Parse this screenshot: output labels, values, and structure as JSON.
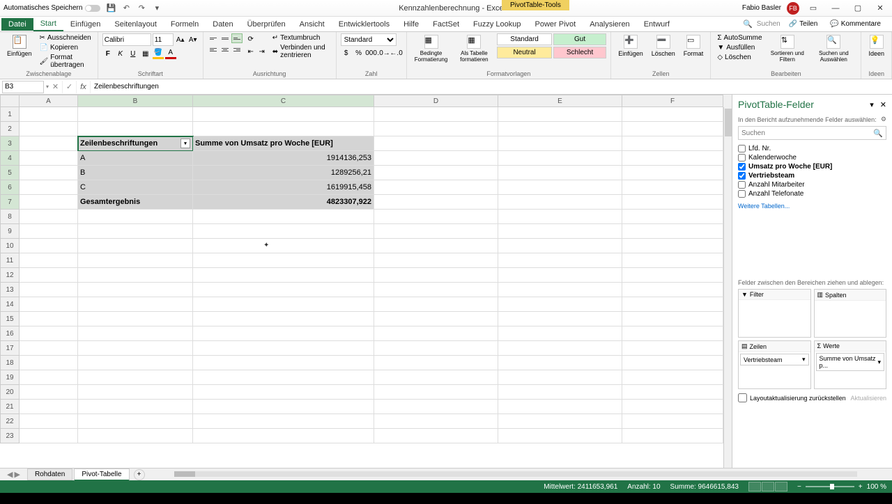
{
  "titlebar": {
    "autosave": "Automatisches Speichern",
    "doc_title": "Kennzahlenberechnung - Excel",
    "context_tool": "PivotTable-Tools",
    "user_name": "Fabio Basler",
    "user_initials": "FB"
  },
  "tabs": {
    "file": "Datei",
    "start": "Start",
    "einfuegen": "Einfügen",
    "seitenlayout": "Seitenlayout",
    "formeln": "Formeln",
    "daten": "Daten",
    "ueberpruefen": "Überprüfen",
    "ansicht": "Ansicht",
    "entwickler": "Entwicklertools",
    "hilfe": "Hilfe",
    "factset": "FactSet",
    "fuzzy": "Fuzzy Lookup",
    "powerpivot": "Power Pivot",
    "analysieren": "Analysieren",
    "entwurf": "Entwurf",
    "suchen": "Suchen",
    "teilen": "Teilen",
    "kommentare": "Kommentare"
  },
  "ribbon": {
    "clipboard": {
      "einfuegen": "Einfügen",
      "ausschneiden": "Ausschneiden",
      "kopieren": "Kopieren",
      "pinsel": "Format übertragen",
      "label": "Zwischenablage"
    },
    "font": {
      "name": "Calibri",
      "size": "11",
      "label": "Schriftart"
    },
    "align": {
      "umbruch": "Textumbruch",
      "verbinden": "Verbinden und zentrieren",
      "label": "Ausrichtung"
    },
    "number": {
      "format": "Standard",
      "label": "Zahl"
    },
    "styles": {
      "bedingte": "Bedingte\nFormatierung",
      "alstabelle": "Als Tabelle\nformatieren",
      "standard": "Standard",
      "gut": "Gut",
      "neutral": "Neutral",
      "schlecht": "Schlecht",
      "label": "Formatvorlagen"
    },
    "cells": {
      "einfuegen": "Einfügen",
      "loeschen": "Löschen",
      "format": "Format",
      "label": "Zellen"
    },
    "edit": {
      "autosumme": "AutoSumme",
      "ausfuellen": "Ausfüllen",
      "loeschen": "Löschen",
      "sortieren": "Sortieren und\nFiltern",
      "suchen": "Suchen und\nAuswählen",
      "label": "Bearbeiten"
    },
    "ideas": {
      "ideen": "Ideen",
      "label": "Ideen"
    }
  },
  "formula": {
    "cell": "B3",
    "value": "Zeilenbeschriftungen"
  },
  "columns": [
    "A",
    "B",
    "C",
    "D",
    "E",
    "F"
  ],
  "pivot": {
    "h1": "Zeilenbeschriftungen",
    "h2": "Summe von Umsatz pro Woche [EUR]",
    "rows": [
      {
        "label": "A",
        "value": "1914136,253"
      },
      {
        "label": "B",
        "value": "1289256,21"
      },
      {
        "label": "C",
        "value": "1619915,458"
      }
    ],
    "total_label": "Gesamtergebnis",
    "total_value": "4823307,922"
  },
  "pane": {
    "title": "PivotTable-Felder",
    "sub": "In den Bericht aufzunehmende Felder auswählen:",
    "search": "Suchen",
    "fields": [
      {
        "label": "Lfd. Nr.",
        "checked": false
      },
      {
        "label": "Kalenderwoche",
        "checked": false
      },
      {
        "label": "Umsatz pro Woche [EUR]",
        "checked": true
      },
      {
        "label": "Vertriebsteam",
        "checked": true
      },
      {
        "label": "Anzahl Mitarbeiter",
        "checked": false
      },
      {
        "label": "Anzahl Telefonate",
        "checked": false
      }
    ],
    "more": "Weitere Tabellen...",
    "areas_sub": "Felder zwischen den Bereichen ziehen und ablegen:",
    "filter": "Filter",
    "spalten": "Spalten",
    "zeilen": "Zeilen",
    "werte": "Werte",
    "zeilen_item": "Vertriebsteam",
    "werte_item": "Summe von Umsatz p...",
    "defer": "Layoutaktualisierung zurückstellen",
    "update": "Aktualisieren"
  },
  "sheets": {
    "s1": "Rohdaten",
    "s2": "Pivot-Tabelle"
  },
  "status": {
    "mittel": "Mittelwert: 2411653,961",
    "anzahl": "Anzahl: 10",
    "summe": "Summe: 9646615,843",
    "zoom": "100 %"
  }
}
